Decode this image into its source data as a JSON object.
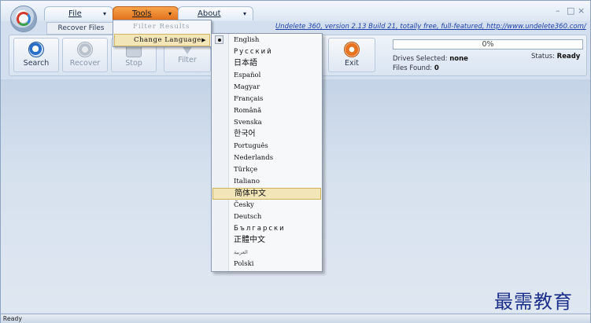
{
  "menubar": {
    "file_label": "File",
    "tools_label": "Tools",
    "about_label": "About",
    "arrow": "▾"
  },
  "window_controls": {
    "minimize": "–",
    "maximize": "□",
    "close": "×"
  },
  "ribbon": {
    "tab_label": "Recover Files",
    "version_text": "Undelete 360, version 2.13 Build 21, totally free, full-featured, http://www.undelete360.com/",
    "buttons": {
      "search": "Search",
      "recover": "Recover",
      "stop": "Stop",
      "filter": "Filter",
      "exit": "Exit"
    }
  },
  "status_panel": {
    "progress_text": "0%",
    "progress_value": 0,
    "drives_label": "Drives Selected:",
    "drives_value": "none",
    "files_label": "Files Found:",
    "files_value": "0",
    "status_label": "Status:",
    "status_value": "Ready"
  },
  "tools_menu": {
    "filter_results": "Filter Results",
    "change_language": "Change Language",
    "submenu_arrow": "▶"
  },
  "languages": {
    "selected": "English",
    "highlighted": "简体中文",
    "items": [
      "English",
      "Русский",
      "日本語",
      "Español",
      "Magyar",
      "Français",
      "Română",
      "Svenska",
      "한국어",
      "Português",
      "Nederlands",
      "Türkçe",
      "Italiano",
      "简体中文",
      "Česky",
      "Deutsch",
      "Български",
      "正體中文",
      "العربية",
      "Polski"
    ]
  },
  "statusbar": {
    "text": "Ready"
  },
  "watermark": {
    "text": "最需教育"
  },
  "colors": {
    "accent": "#e57a22",
    "highlight": "#f2e5b8",
    "link": "#1d3fa8"
  }
}
